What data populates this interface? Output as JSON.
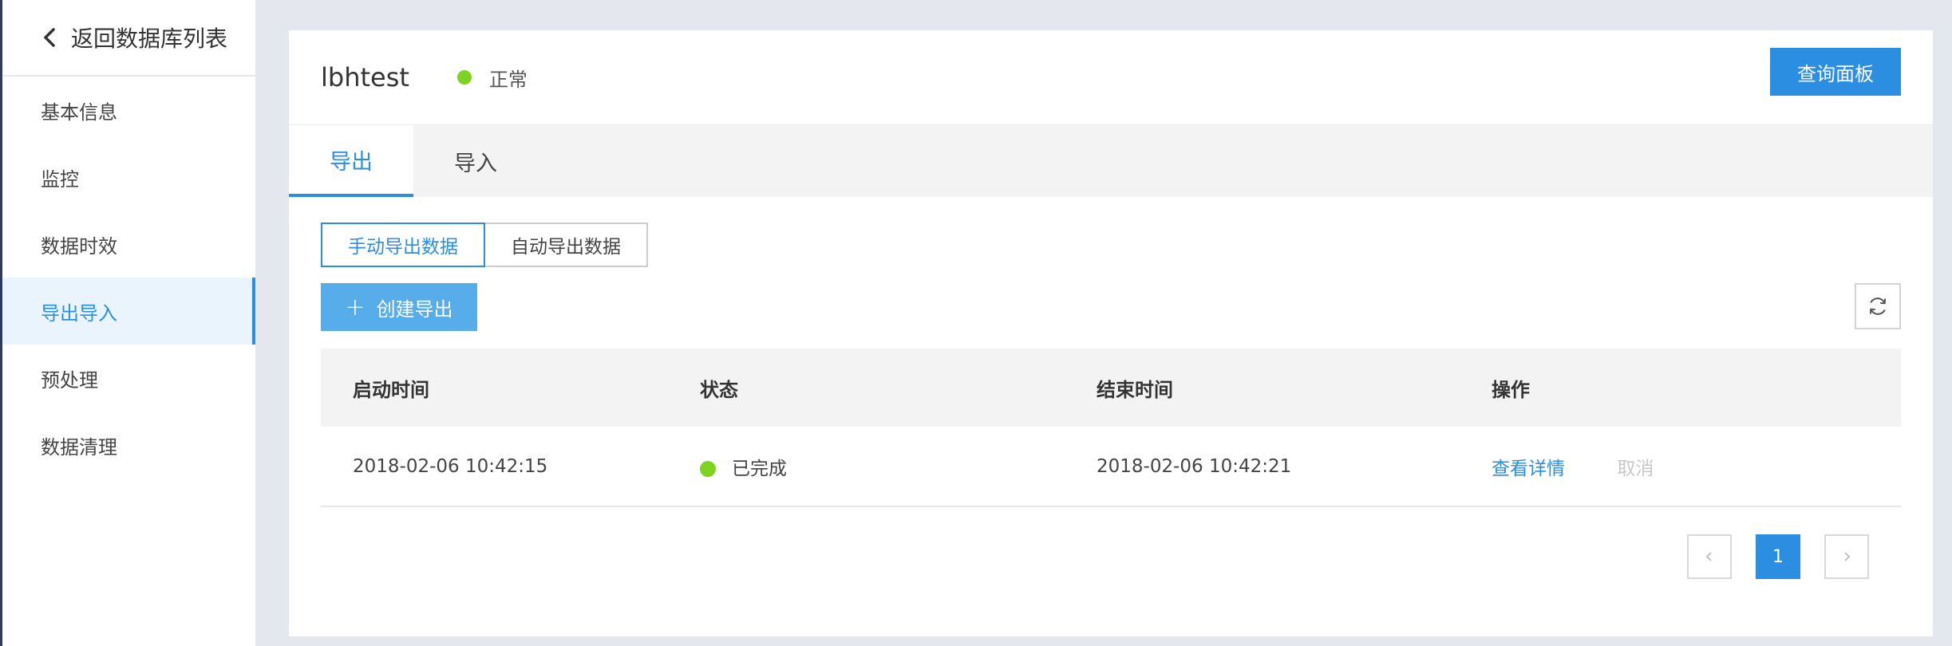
{
  "sidebar": {
    "back_label": "返回数据库列表",
    "items": [
      {
        "label": "基本信息"
      },
      {
        "label": "监控"
      },
      {
        "label": "数据时效"
      },
      {
        "label": "导出导入"
      },
      {
        "label": "预处理"
      },
      {
        "label": "数据清理"
      }
    ],
    "active_item": "导出导入"
  },
  "header": {
    "db_name": "lbhtest",
    "status": "正常",
    "status_color": "#7ed321",
    "query_button": "查询面板"
  },
  "tabs": [
    {
      "label": "导出",
      "active": true
    },
    {
      "label": "导入",
      "active": false
    }
  ],
  "segment": {
    "manual": "手动导出数据",
    "auto": "自动导出数据",
    "selected": "手动导出数据"
  },
  "toolbar": {
    "create_label": "创建导出",
    "create_icon": "plus-icon",
    "refresh_icon": "refresh-icon"
  },
  "table": {
    "columns": [
      "启动时间",
      "状态",
      "结束时间",
      "操作"
    ],
    "rows": [
      {
        "start": "2018-02-06 10:42:15",
        "status": "已完成",
        "end": "2018-02-06 10:42:21",
        "action_view": "查看详情",
        "action_cancel": "取消"
      }
    ]
  },
  "pagination": {
    "current_page": "1",
    "prev_icon": "chevron-left-icon",
    "next_icon": "chevron-right-icon"
  },
  "colors": {
    "accent": "#2b8ee0",
    "success": "#7ed321",
    "sidebar_border": "#2e3a59"
  }
}
